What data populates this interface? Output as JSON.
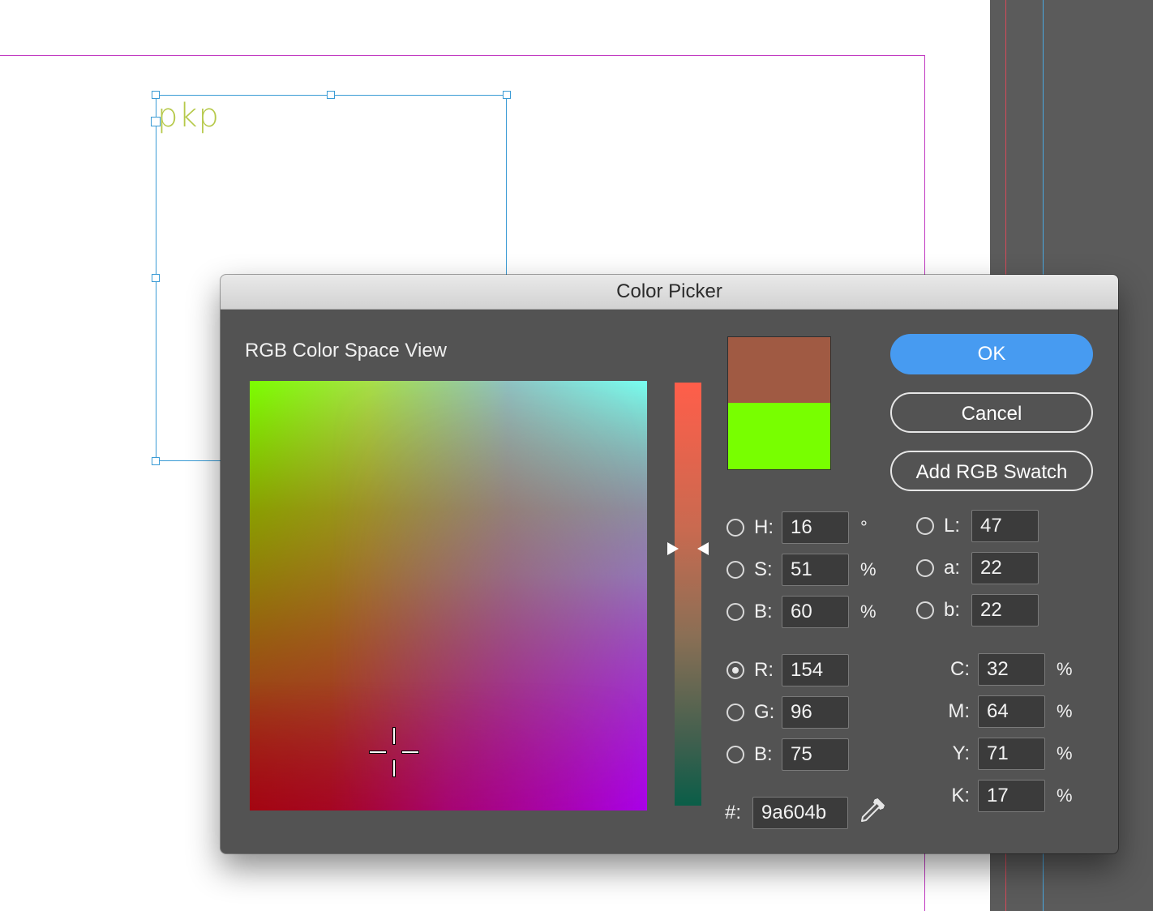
{
  "document": {
    "frame_text": "pkp"
  },
  "dialog": {
    "title": "Color Picker",
    "section_title": "RGB Color Space View",
    "buttons": {
      "ok": "OK",
      "cancel": "Cancel",
      "add_swatch": "Add RGB Swatch"
    },
    "swatches": {
      "new_color": "#a05a43",
      "original_color": "#78ff00"
    },
    "hsb": {
      "h": {
        "label": "H:",
        "value": "16",
        "unit": "°"
      },
      "s": {
        "label": "S:",
        "value": "51",
        "unit": "%"
      },
      "b": {
        "label": "B:",
        "value": "60",
        "unit": "%"
      }
    },
    "lab": {
      "l": {
        "label": "L:",
        "value": "47"
      },
      "a": {
        "label": "a:",
        "value": "22"
      },
      "b": {
        "label": "b:",
        "value": "22"
      }
    },
    "rgb": {
      "r": {
        "label": "R:",
        "value": "154"
      },
      "g": {
        "label": "G:",
        "value": "96"
      },
      "b": {
        "label": "B:",
        "value": "75"
      }
    },
    "cmyk": {
      "c": {
        "label": "C:",
        "value": "32",
        "unit": "%"
      },
      "m": {
        "label": "M:",
        "value": "64",
        "unit": "%"
      },
      "y": {
        "label": "Y:",
        "value": "71",
        "unit": "%"
      },
      "k": {
        "label": "K:",
        "value": "17",
        "unit": "%"
      }
    },
    "hex": {
      "label": "#:",
      "value": "9a604b"
    },
    "selected_mode": "R"
  }
}
